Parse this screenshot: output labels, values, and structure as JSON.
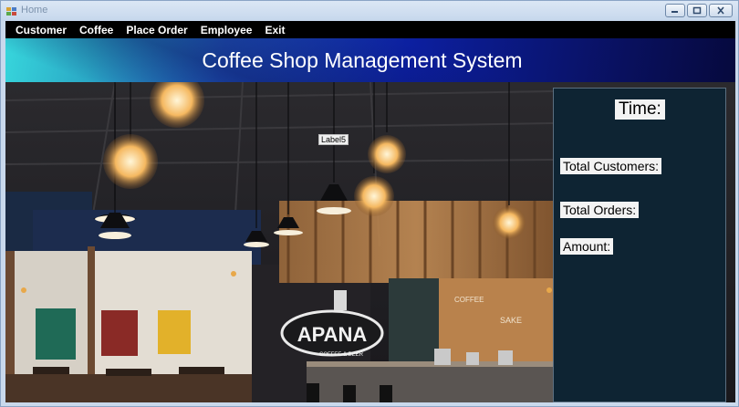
{
  "window": {
    "title": "Home"
  },
  "menu": {
    "items": [
      "Customer",
      "Coffee",
      "Place Order",
      "Employee",
      "Exit"
    ]
  },
  "banner": {
    "title": "Coffee Shop Management System"
  },
  "photo": {
    "label5": "Label5",
    "sign_text": "APANA",
    "sign_subtext": "COFFEE & BEER",
    "wall_text_1": "COFFEE",
    "wall_text_2": "SAKE"
  },
  "stats": {
    "time_label": "Time:",
    "customers_label": "Total Customers:",
    "orders_label": "Total Orders:",
    "amount_label": "Amount:"
  },
  "colors": {
    "menubar": "#000000",
    "banner_start": "#37d6dc",
    "banner_end": "#06093d",
    "stats_panel": "#0e2433"
  }
}
